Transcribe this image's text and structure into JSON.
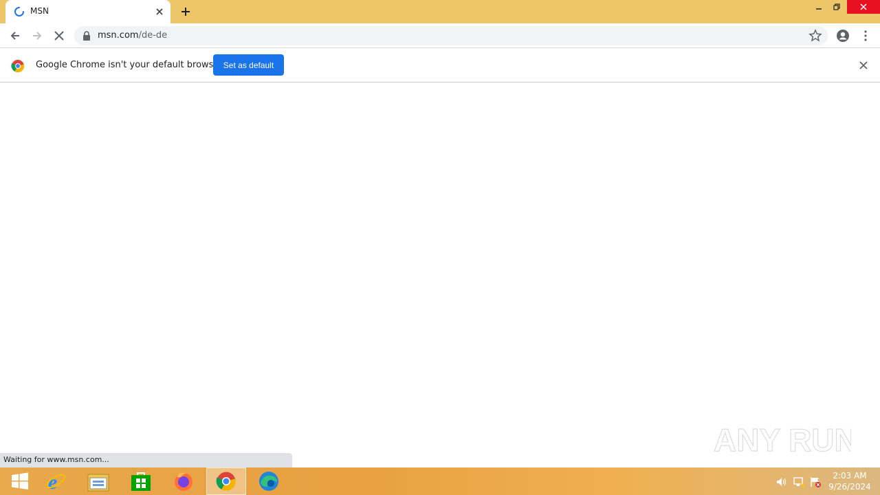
{
  "tab": {
    "title": "MSN"
  },
  "toolbar": {
    "url_host": "msn.com",
    "url_path": "/de-de"
  },
  "infobar": {
    "message": "Google Chrome isn't your default browser",
    "button_label": "Set as default"
  },
  "status": {
    "text": "Waiting for www.msn.com..."
  },
  "taskbar": {
    "time": "2:03 AM",
    "date": "9/26/2024"
  },
  "watermark": {
    "text": "ANY RUN"
  },
  "colors": {
    "titlebar": "#eec66a",
    "button_blue": "#1a73e8",
    "close_red": "#e81123"
  }
}
